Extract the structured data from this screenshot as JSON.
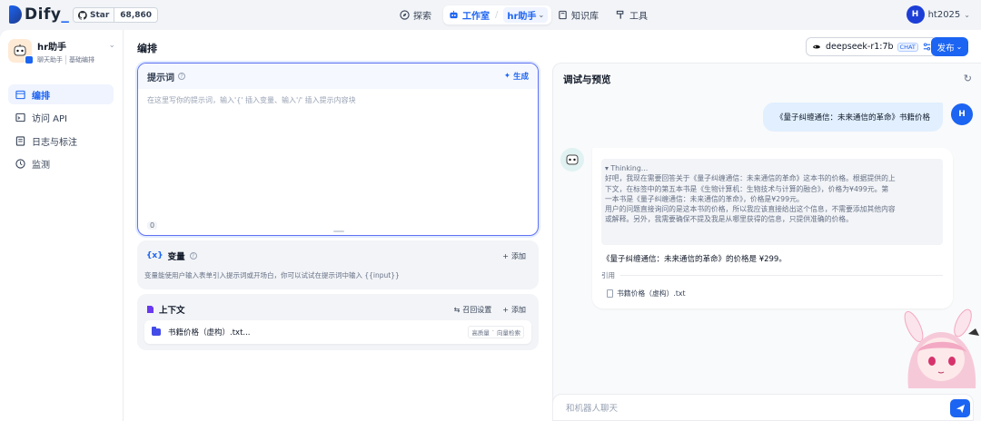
{
  "brand": {
    "name": "Dify",
    "accent": "#1c64f2"
  },
  "github": {
    "star_label": "Star",
    "star_count": "68,860"
  },
  "nav": {
    "explore": "探索",
    "studio": "工作室",
    "current_app": "hr助手",
    "knowledge": "知识库",
    "tools": "工具"
  },
  "user": {
    "initial": "H",
    "name": "ht2025"
  },
  "app": {
    "name": "hr助手",
    "mode": "聊天助手",
    "type": "基础编排"
  },
  "sidebar": {
    "items": [
      {
        "label": "编排",
        "icon": "layout-icon",
        "active": true
      },
      {
        "label": "访问 API",
        "icon": "terminal-icon",
        "active": false
      },
      {
        "label": "日志与标注",
        "icon": "logs-icon",
        "active": false
      },
      {
        "label": "监测",
        "icon": "monitor-icon",
        "active": false
      }
    ]
  },
  "orchestrate": {
    "title": "编排",
    "model": {
      "name": "deepseek-r1:7b",
      "tag": "CHAT"
    },
    "publish": "发布",
    "prompt": {
      "title": "提示词",
      "generate": "生成",
      "placeholder": "在这里写你的提示词，输入'{' 插入变量、输入'/' 插入提示内容块",
      "count": "0"
    },
    "variables": {
      "icon_text": "{x}",
      "title": "变量",
      "add": "添加",
      "description": "变量能使用户输入表单引入提示词或开场白，你可以试试在提示词中输入 {{input}}"
    },
    "context": {
      "title": "上下文",
      "recall_settings": "召回设置",
      "add": "添加",
      "item": {
        "name": "书籍价格（虚构）.txt...",
        "tag_quality": "高质量",
        "tag_index": "向量检索"
      }
    }
  },
  "debug": {
    "title": "调试与预览",
    "user_message": "《量子纠缠通信：未来通信的革命》书籍价格",
    "thinking_head": "▾ Thinking...",
    "thinking_lines": [
      "好吧，我现在需要回答关于《量子纠缠通信：未来通信的革命》这本书的价格。根据提供的上",
      "下文，在标签中的第五本书是《生物计算机：生物技术与计算的融合》，价格为¥499元。第",
      "一本书是《量子纠缠通信：未来通信的革命》，价格是¥299元。",
      "用户的问题直接询问的是这本书的价格，所以我应该直接给出这个信息，不需要添加其他内容",
      "或解释。另外，我需要确保不提及我是从哪里获得的信息，只提供准确的价格。"
    ],
    "answer": "《量子纠缠通信：未来通信的革命》的价格是 ¥299。",
    "citation_label": "引用",
    "citation_file": "书籍价格（虚构）.txt",
    "input_placeholder": "和机器人聊天"
  }
}
